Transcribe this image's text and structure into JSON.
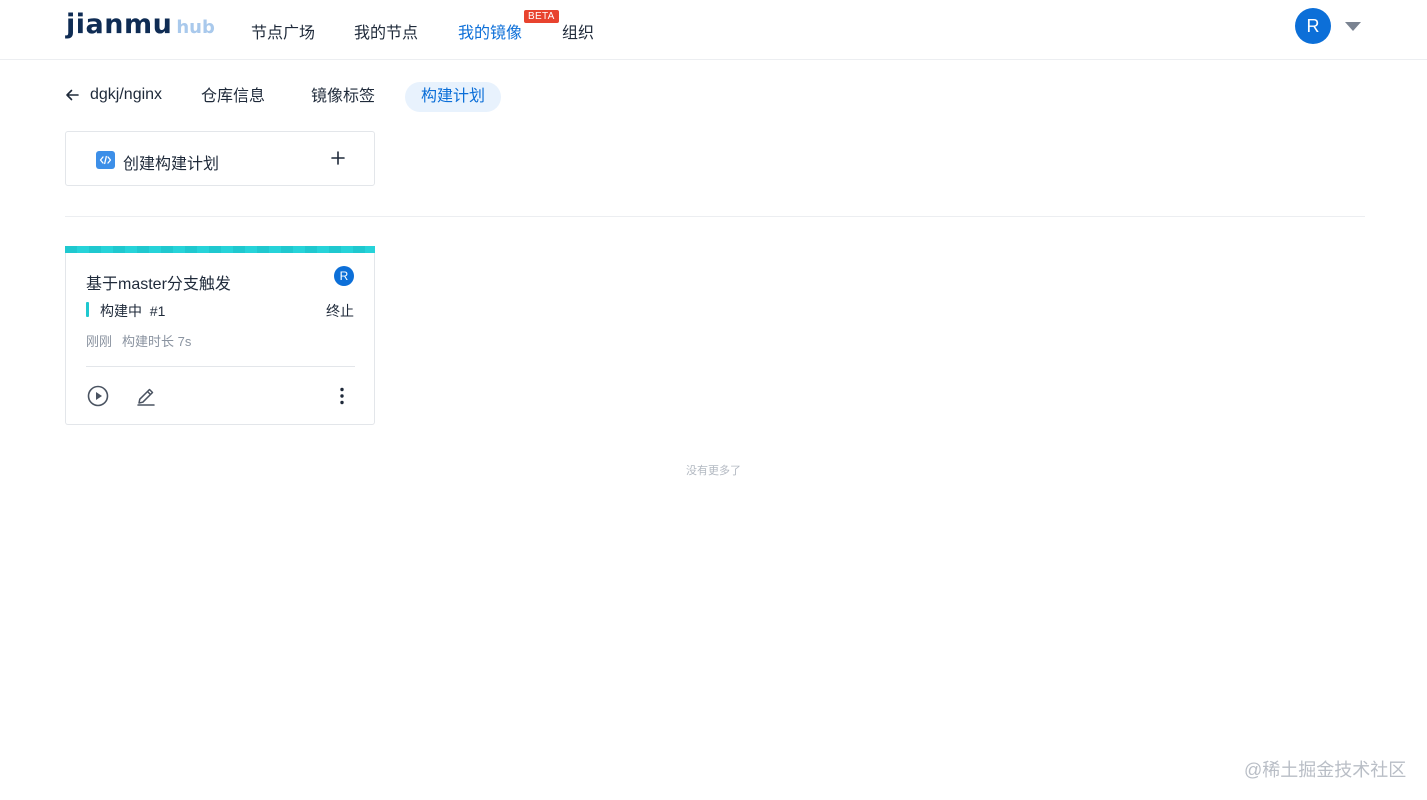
{
  "header": {
    "logo_main": "jianmu",
    "logo_sub": "hub",
    "nav": [
      {
        "label": "节点广场",
        "active": false
      },
      {
        "label": "我的节点",
        "active": false
      },
      {
        "label": "我的镜像",
        "active": true
      },
      {
        "label": "组织",
        "active": false
      }
    ],
    "beta_badge": "BETA",
    "user_avatar": "R",
    "user_menu_icon": "caret-down-icon"
  },
  "subnav": {
    "back_icon": "arrow-left-icon",
    "repo_name": "dgkj/nginx",
    "tabs": [
      {
        "label": "仓库信息",
        "active": false
      },
      {
        "label": "镜像标签",
        "active": false
      },
      {
        "label": "构建计划",
        "active": true
      }
    ]
  },
  "create_plan": {
    "icon": "code-icon",
    "label": "创建构建计划",
    "add_icon": "plus-icon"
  },
  "plans": [
    {
      "title": "基于master分支触发",
      "avatar": "R",
      "status": "构建中",
      "build_number": "#1",
      "stop_label": "终止",
      "time_ago": "刚刚",
      "duration": "构建时长 7s",
      "status_color": "#1fc8cf",
      "actions": [
        "play-icon",
        "edit-icon",
        "more-icon"
      ]
    }
  ],
  "footer": {
    "no_more": "没有更多了"
  },
  "watermark": "@稀土掘金技术社区",
  "colors": {
    "accent": "#0c6fd8",
    "building": "#1fc8cf",
    "beta": "#e8432e"
  }
}
